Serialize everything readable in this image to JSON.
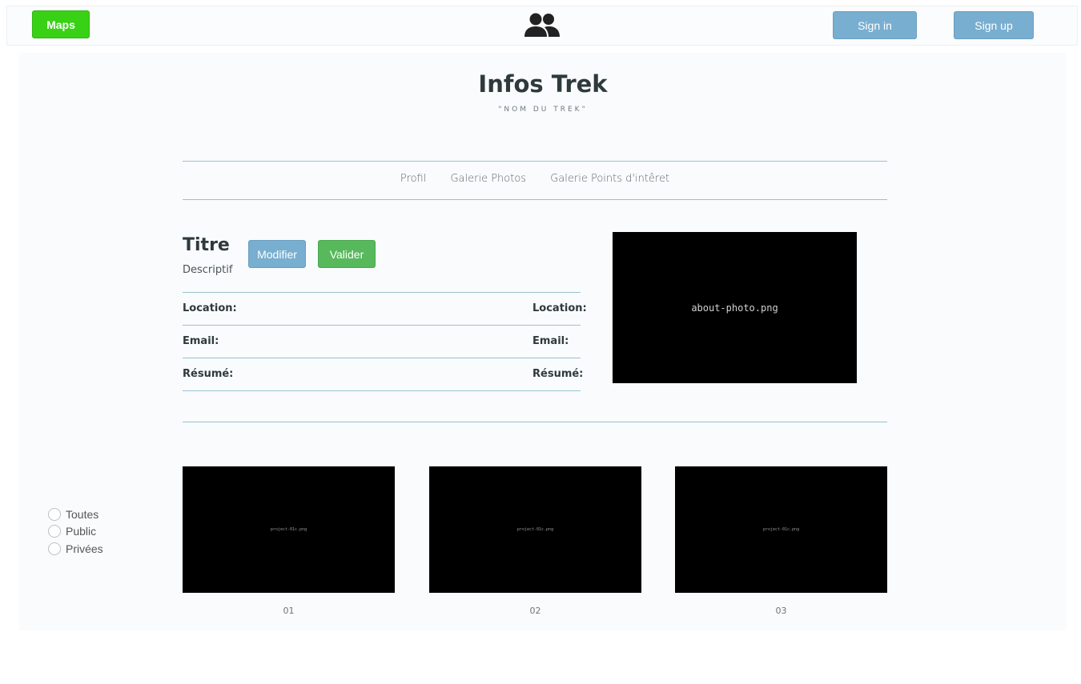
{
  "topbar": {
    "maps_label": "Maps",
    "signin_label": "Sign in",
    "signup_label": "Sign up",
    "center_icon": "users-icon",
    "maps_color": "#39d115",
    "auth_button_color": "#78aed0"
  },
  "header": {
    "title": "Infos Trek",
    "subtitle": "\"NOM DU TREK\""
  },
  "nav": {
    "items": [
      "Profil",
      "Galerie Photos",
      "Galerie Points d'intêret"
    ]
  },
  "profile": {
    "title": "Titre",
    "description": "Descriptif",
    "modifier_label": "Modifier",
    "valider_label": "Valider",
    "rows": [
      {
        "left": "Location:",
        "right": "Location:"
      },
      {
        "left": "Email:",
        "right": "Email:"
      },
      {
        "left": "Résumé:",
        "right": "Résumé:"
      }
    ],
    "photo_label": "about-photo.png"
  },
  "filters": {
    "options": [
      "Toutes",
      "Public",
      "Privées"
    ]
  },
  "projects": [
    {
      "image_label": "project-01c.png",
      "number": "01"
    },
    {
      "image_label": "project-01c.png",
      "number": "02"
    },
    {
      "image_label": "project-01c.png",
      "number": "03"
    }
  ]
}
